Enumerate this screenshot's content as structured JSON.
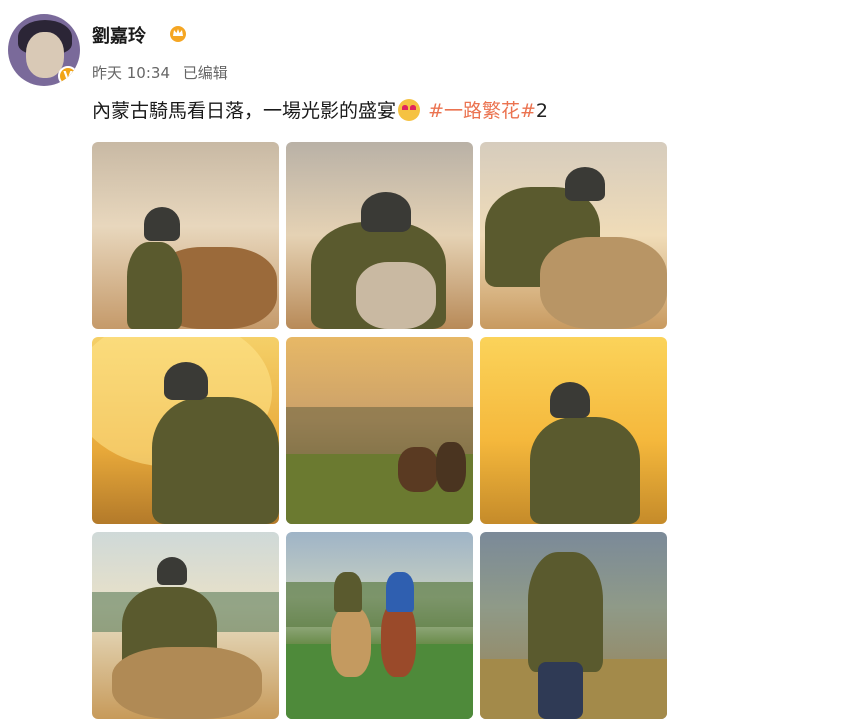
{
  "user": {
    "name": "劉嘉玲",
    "verified_badge": "V"
  },
  "meta": {
    "time": "昨天 10:34",
    "edited": "已编辑"
  },
  "post": {
    "text": "內蒙古騎馬看日落，一場光影的盛宴",
    "hashtag": "#一路繁花#",
    "hashtag_suffix": "2"
  },
  "icons": {
    "vip": "crown-icon",
    "emoji": "heart-eyes-emoji-icon"
  },
  "colors": {
    "hashtag": "#eb7350",
    "badge": "#f2a516"
  },
  "photos": {
    "count": 9
  }
}
